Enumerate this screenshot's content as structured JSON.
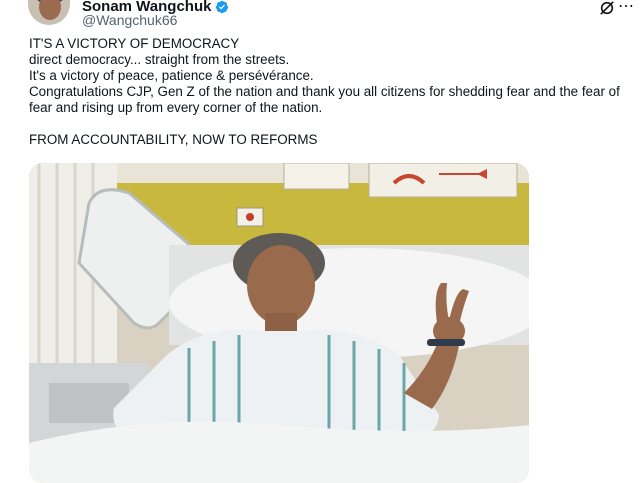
{
  "author": {
    "display_name": "Sonam Wangchuk",
    "handle": "@Wangchuk66"
  },
  "icons": {
    "verified": "verified-badge-icon",
    "grok": "grok-icon",
    "more": "more-options-icon"
  },
  "tweet": {
    "lines": [
      "IT'S A VICTORY OF DEMOCRACY",
      "direct democracy... straight from the streets.",
      "It's a victory of peace, patience & persévérance.",
      "Congratulations CJP,  Gen Z of the nation and thank you all citizens for shedding fear and the fear of fear and rising up from every corner of the nation."
    ],
    "closing": "FROM ACCOUNTABILITY,  NOW TO REFORMS"
  },
  "colors": {
    "verified": "#1d9bf0",
    "handle": "#536471"
  }
}
